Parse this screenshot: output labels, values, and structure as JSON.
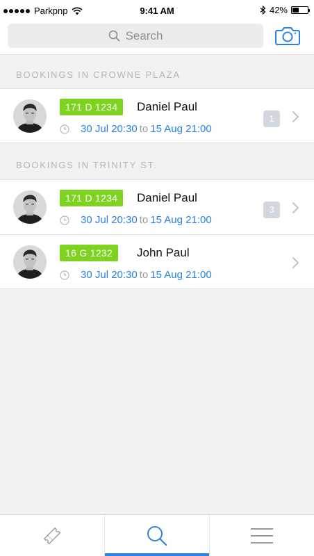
{
  "status_bar": {
    "carrier": "Parkpnp",
    "time": "9:41 AM",
    "battery": "42%",
    "battery_level": 0.42
  },
  "header": {
    "search_placeholder": "Search",
    "search_icon": "search-icon",
    "camera_icon": "camera-icon"
  },
  "sections": [
    {
      "title": "BOOKINGS IN CROWNE PLAZA",
      "rows": [
        {
          "plate": "171 D 1234",
          "name": "Daniel Paul",
          "start": "30 Jul 20:30",
          "to": "to",
          "end": "15 Aug 21:00",
          "count": "1"
        }
      ]
    },
    {
      "title": "BOOKINGS IN TRINITY ST.",
      "rows": [
        {
          "plate": "171 D 1234",
          "name": "Daniel Paul",
          "start": "30 Jul 20:30",
          "to": "to",
          "end": "15 Aug 21:00",
          "count": "3"
        },
        {
          "plate": "16 G 1232",
          "name": "John Paul",
          "start": "30 Jul 20:30",
          "to": "to",
          "end": "15 Aug 21:00",
          "count": ""
        }
      ]
    }
  ],
  "tab_bar": {
    "tabs": [
      {
        "icon": "ticket-icon",
        "active": false
      },
      {
        "icon": "search-icon",
        "active": true
      },
      {
        "icon": "menu-icon",
        "active": false
      }
    ]
  },
  "colors": {
    "accent": "#2a82e4",
    "plate_green": "#7ed321",
    "badge_gray": "#d2d6dd"
  }
}
